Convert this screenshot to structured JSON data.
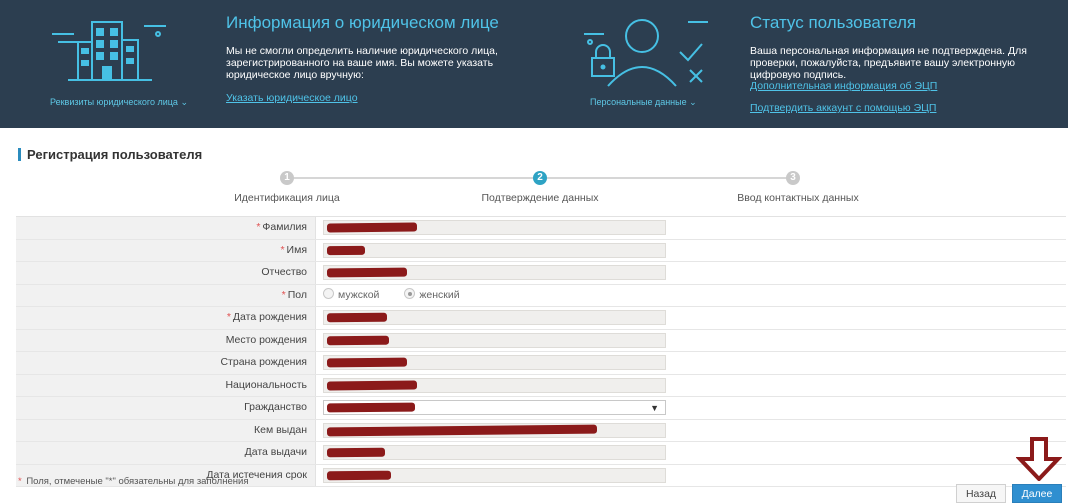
{
  "banner": {
    "left": {
      "icon": "building-icon",
      "caption": "Реквизиты юридического лица",
      "title": "Информация о юридическом лице",
      "text": "Мы не смогли определить наличие юридического лица, зарегистрированного на ваше имя. Вы можете указать юридическое лицо вручную:",
      "link": "Указать юридическое лицо"
    },
    "right": {
      "icon": "user-lock-icon",
      "caption": "Персональные данные",
      "title": "Статус пользователя",
      "text": "Ваша персональная информация не подтверждена. Для проверки, пожалуйста, предъявите вашу электронную цифровую подпись.",
      "link1": "Дополнительная информация об ЭЦП",
      "link2": "Подтвердить аккаунт с помощью ЭЦП"
    }
  },
  "section": {
    "title": "Регистрация пользователя"
  },
  "steps": [
    {
      "number": "1",
      "label": "Идентификация лица",
      "active": false
    },
    {
      "number": "2",
      "label": "Подтверждение данных",
      "active": true
    },
    {
      "number": "3",
      "label": "Ввод контактных данных",
      "active": false
    }
  ],
  "form": {
    "fields": [
      {
        "label": "Фамилия",
        "required": true,
        "type": "text"
      },
      {
        "label": "Имя",
        "required": true,
        "type": "text"
      },
      {
        "label": "Отчество",
        "required": false,
        "type": "text"
      },
      {
        "label": "Пол",
        "required": true,
        "type": "radio",
        "options": [
          "мужской",
          "женский"
        ],
        "selected": "женский"
      },
      {
        "label": "Дата рождения",
        "required": true,
        "type": "text"
      },
      {
        "label": "Место рождения",
        "required": false,
        "type": "text"
      },
      {
        "label": "Страна рождения",
        "required": false,
        "type": "text"
      },
      {
        "label": "Национальность",
        "required": false,
        "type": "text"
      },
      {
        "label": "Гражданство",
        "required": false,
        "type": "select"
      },
      {
        "label": "Кем выдан",
        "required": false,
        "type": "text"
      },
      {
        "label": "Дата выдачи",
        "required": false,
        "type": "text"
      },
      {
        "label": "Дата истечения срок",
        "required": false,
        "type": "text"
      }
    ],
    "required_mark": "*",
    "note": "Поля, отмеченые \"*\" обязательны для заполнения"
  },
  "buttons": {
    "back": "Назад",
    "next": "Далее"
  },
  "colors": {
    "banner_bg": "#2c3e50",
    "accent": "#2ea3c4",
    "redaction": "#8b1a1a",
    "pointer_arrow": "#8b1a1a"
  }
}
